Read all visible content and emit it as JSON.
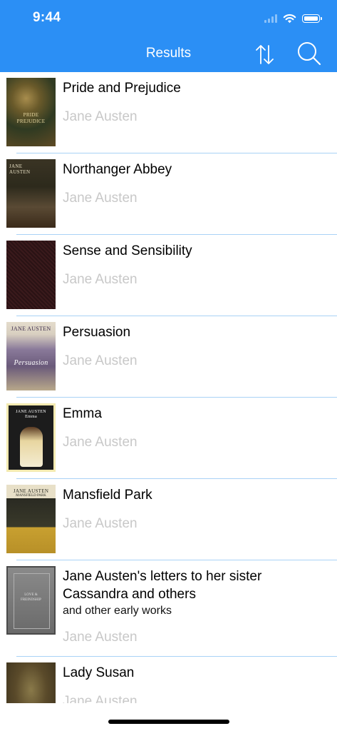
{
  "status_bar": {
    "time": "9:44"
  },
  "nav": {
    "title": "Results",
    "sort_icon": "sort-arrows-icon",
    "search_icon": "search-icon"
  },
  "colors": {
    "header": "#2b8ff5",
    "separator": "#a9d2f6",
    "author": "#c8c8c8"
  },
  "books": [
    {
      "title": "Pride and Prejudice",
      "subtitle": "",
      "author": "Jane Austen",
      "cover_colors": [
        "#5e4a24",
        "#2f3a22",
        "#a88d4d"
      ]
    },
    {
      "title": "Northanger Abbey",
      "subtitle": "",
      "author": "Jane Austen",
      "cover_colors": [
        "#2d2a1c",
        "#5a4a34",
        "#e8e0c4"
      ]
    },
    {
      "title": "Sense and Sensibility",
      "subtitle": "",
      "author": "Jane Austen",
      "cover_colors": [
        "#3a1a1c",
        "#2a1214",
        "#4a2426"
      ]
    },
    {
      "title": "Persuasion",
      "subtitle": "",
      "author": "Jane Austen",
      "cover_colors": [
        "#d8cfc0",
        "#6a5a7a",
        "#b8a88a"
      ]
    },
    {
      "title": "Emma",
      "subtitle": "",
      "author": "Jane Austen",
      "cover_colors": [
        "#1c1c1c",
        "#e8d6a0",
        "#5a6a3a"
      ]
    },
    {
      "title": "Mansfield Park",
      "subtitle": "",
      "author": "Jane Austen",
      "cover_colors": [
        "#e8e0c8",
        "#2a2a22",
        "#c8a030"
      ]
    },
    {
      "title": "Jane Austen's letters to her sister Cassandra and others",
      "subtitle": "and other early works",
      "author": "Jane Austen",
      "cover_colors": [
        "#7a7a7a",
        "#4a4a4a",
        "#b0b0b0"
      ]
    },
    {
      "title": "Lady Susan",
      "subtitle": "",
      "author": "Jane Austen",
      "cover_colors": [
        "#5a4a2a",
        "#3a301c",
        "#8a7a4a"
      ]
    }
  ]
}
